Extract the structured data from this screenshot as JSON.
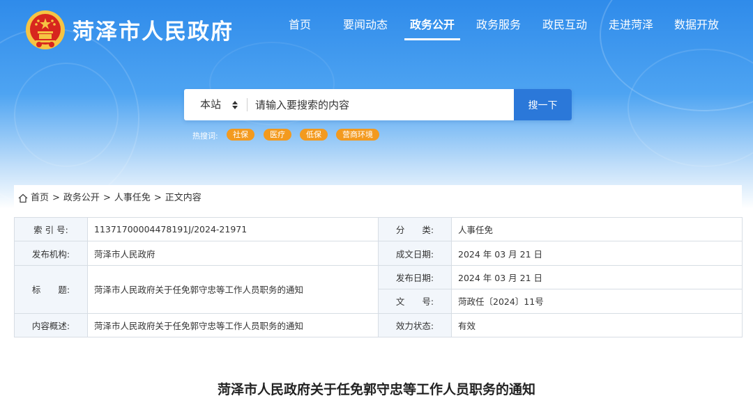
{
  "header": {
    "site_title": "菏泽市人民政府",
    "logo_icon": "national-emblem-icon",
    "nav": [
      {
        "label": "首页",
        "active": false
      },
      {
        "label": "要闻动态",
        "active": false
      },
      {
        "label": "政务公开",
        "active": true
      },
      {
        "label": "政务服务",
        "active": false
      },
      {
        "label": "政民互动",
        "active": false
      },
      {
        "label": "走进菏泽",
        "active": false
      },
      {
        "label": "数据开放",
        "active": false
      }
    ]
  },
  "search": {
    "scope": "本站",
    "placeholder": "请输入要搜索的内容",
    "button_label": "搜一下",
    "hot_label": "热搜词:",
    "hot_tags": [
      "社保",
      "医疗",
      "低保",
      "营商环境"
    ]
  },
  "breadcrumb": {
    "items": [
      "首页",
      "政务公开",
      "人事任免",
      "正文内容"
    ],
    "separator": ">"
  },
  "meta": {
    "index_no_label": "索 引 号:",
    "index_no": "11371700004478191J/2024-21971",
    "category_label": "分　　类:",
    "category": "人事任免",
    "publisher_label": "发布机构:",
    "publisher": "菏泽市人民政府",
    "created_label": "成文日期:",
    "created": "2024 年 03 月 21 日",
    "title_label": "标　　题:",
    "title": "菏泽市人民政府关于任免郭守忠等工作人员职务的通知",
    "published_label": "发布日期:",
    "published": "2024 年 03 月 21 日",
    "doc_no_label": "文　　号:",
    "doc_no": "菏政任〔2024〕11号",
    "summary_label": "内容概述:",
    "summary": "菏泽市人民政府关于任免郭守忠等工作人员职务的通知",
    "status_label": "效力状态:",
    "status": "有效"
  },
  "document": {
    "title": "菏泽市人民政府关于任免郭守忠等工作人员职务的通知"
  },
  "colors": {
    "header_blue": "#2f8bea",
    "search_button": "#2b78d9",
    "hot_tag": "#f39a1f",
    "label_cell_bg": "#f2f6fb"
  }
}
